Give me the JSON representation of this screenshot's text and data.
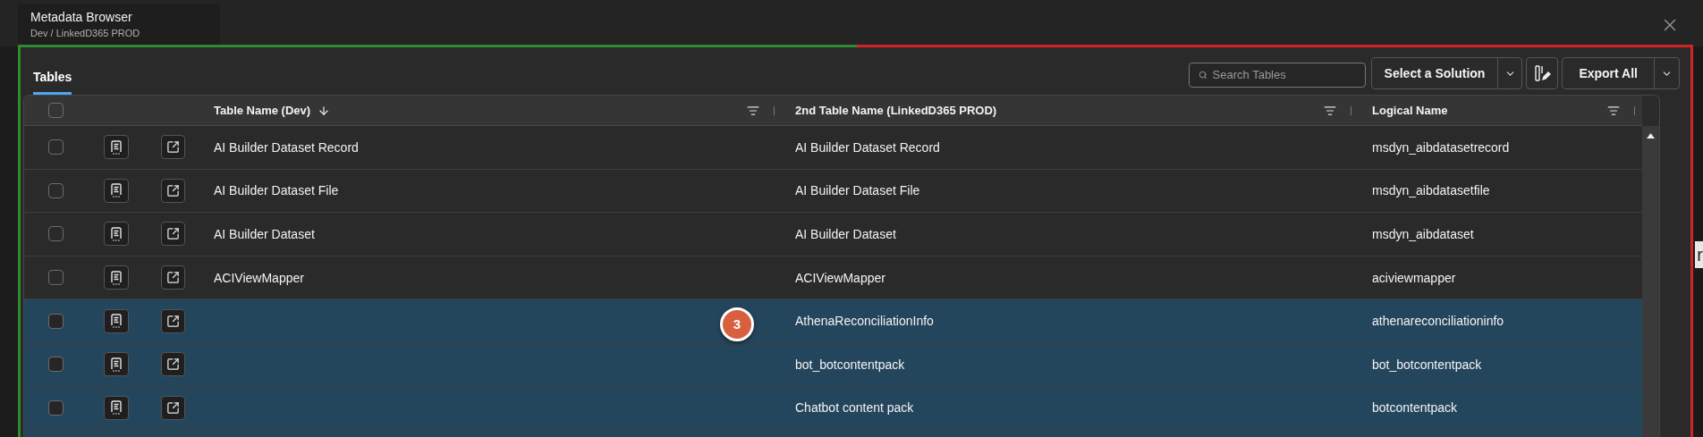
{
  "window": {
    "tab": {
      "title": "Metadata Browser",
      "subtitle": "Dev / LinkedD365 PROD",
      "selected": true
    }
  },
  "panel": {
    "tabs": [
      {
        "label": "Tables",
        "selected": true
      }
    ],
    "search": {
      "placeholder": "Search Tables"
    },
    "solution_button": "Select a Solution",
    "export_button": "Export All"
  },
  "table": {
    "select_all_checked": false,
    "columns": [
      {
        "label": "Table Name (Dev)",
        "sorted": true
      },
      {
        "label": "2nd Table Name (LinkedD365 PROD)",
        "sorted": false
      },
      {
        "label": "Logical Name",
        "sorted": false
      }
    ],
    "rows": [
      {
        "dev": "AI Builder Dataset Record",
        "prod": "AI Builder Dataset Record",
        "logical": "msdyn_aibdatasetrecord",
        "highlighted": false,
        "checked": false
      },
      {
        "dev": "AI Builder Dataset File",
        "prod": "AI Builder Dataset File",
        "logical": "msdyn_aibdatasetfile",
        "highlighted": false,
        "checked": false
      },
      {
        "dev": "AI Builder Dataset",
        "prod": "AI Builder Dataset",
        "logical": "msdyn_aibdataset",
        "highlighted": false,
        "checked": false
      },
      {
        "dev": "ACIViewMapper",
        "prod": "ACIViewMapper",
        "logical": "aciviewmapper",
        "highlighted": false,
        "checked": false
      },
      {
        "prod": "AthenaReconciliationInfo",
        "logical": "athenareconciliationinfo",
        "highlighted": true,
        "checked": false
      },
      {
        "prod": "bot_botcontentpack",
        "logical": "bot_botcontentpack",
        "highlighted": true,
        "checked": false
      },
      {
        "prod": "Chatbot content pack",
        "logical": "botcontentpack",
        "highlighted": true,
        "checked": false
      },
      {
        "highlighted": true
      }
    ]
  },
  "callout": "3",
  "background_text": "r"
}
